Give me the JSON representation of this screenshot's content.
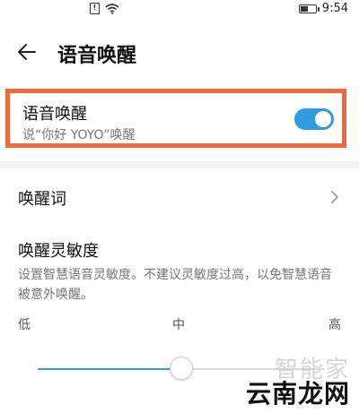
{
  "status_bar": {
    "sim_label": "!",
    "time": "9:54",
    "battery_level": 0.55
  },
  "header": {
    "title": "语音唤醒",
    "back_icon": "arrow-left-icon"
  },
  "voice_wake": {
    "title": "语音唤醒",
    "subtitle": "说“你好 YOYO”唤醒",
    "enabled": true
  },
  "wake_word": {
    "label": "唤醒词",
    "chevron_icon": "chevron-right-icon"
  },
  "sensitivity": {
    "title": "唤醒灵敏度",
    "description": "设置智慧语音灵敏度。不建议灵敏度过高，以免智慧语音被意外唤醒。",
    "levels": {
      "low": "低",
      "mid": "中",
      "high": "高"
    },
    "value": 0.5
  },
  "watermark": {
    "line1": "智能家",
    "line2": "云南龙网"
  },
  "colors": {
    "accent": "#2f9be0",
    "highlight_border": "#ef6a3a"
  }
}
